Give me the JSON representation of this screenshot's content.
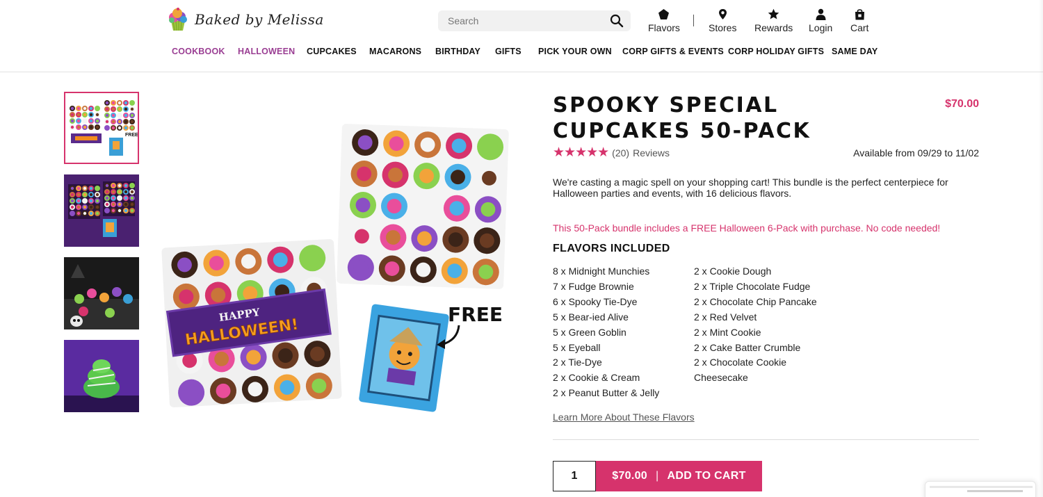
{
  "brand": {
    "logo_text": "Baked by Melissa",
    "primary_color": "#d6336c",
    "accent_purple": "#9a3e93"
  },
  "search": {
    "placeholder": "Search"
  },
  "utility_nav": [
    {
      "label": "Flavors",
      "icon": "flavors-icon"
    },
    {
      "label": "Stores",
      "icon": "map-pin-icon"
    },
    {
      "label": "Rewards",
      "icon": "star-icon"
    },
    {
      "label": "Login",
      "icon": "user-icon"
    },
    {
      "label": "Cart",
      "icon": "shopping-bag-icon"
    }
  ],
  "main_nav": [
    {
      "label": "COOKBOOK",
      "color": "#9a3e93"
    },
    {
      "label": "HALLOWEEN",
      "color": "#9a3e93"
    },
    {
      "label": "CUPCAKES"
    },
    {
      "label": "MACARONS"
    },
    {
      "label": "BIRTHDAY"
    },
    {
      "label": "GIFTS"
    },
    {
      "label": "PICK YOUR OWN"
    },
    {
      "label": "CORP GIFTS & EVENTS"
    },
    {
      "label": "CORP HOLIDAY GIFTS"
    },
    {
      "label": "SAME DAY"
    }
  ],
  "gallery": {
    "thumbnails": [
      {
        "name": "product-thumbnail-bundle",
        "active": true
      },
      {
        "name": "product-thumbnail-purple-boxes"
      },
      {
        "name": "product-thumbnail-party-table"
      },
      {
        "name": "product-thumbnail-green-cupcake"
      }
    ],
    "main_image": {
      "banner_line1": "HAPPY",
      "banner_line2": "HALLOWEEN!",
      "free_label": "FREE"
    }
  },
  "product": {
    "title": "Spooky Special Cupcakes 50-Pack",
    "price": "$70.00",
    "rating": {
      "stars": 5,
      "count": "(20)",
      "label": "Reviews"
    },
    "availability": "Available from 09/29 to 11/02",
    "description": "We're casting a magic spell on your shopping cart! This bundle is the perfect centerpiece for Halloween parties and events, with 16 delicious flavors.",
    "promo": "This 50-Pack bundle includes a FREE Halloween 6-Pack with purchase. No code needed!",
    "flavors_heading": "FLAVORS INCLUDED",
    "flavors_left": [
      "8 x Midnight Munchies",
      "7 x Fudge Brownie",
      "6 x Spooky Tie-Dye",
      "5 x Bear-ied Alive",
      "5 x Green Goblin",
      "5 x Eyeball",
      "2 x Tie-Dye",
      "2 x Cookie & Cream",
      "2 x Peanut Butter & Jelly"
    ],
    "flavors_right": [
      "2 x Cookie Dough",
      "2 x Triple Chocolate Fudge",
      "2 x Chocolate Chip Pancake",
      "2 x Red Velvet",
      "2 x Mint Cookie",
      "2 x Cake Batter Crumble",
      "2 x Chocolate Cookie",
      "Cheesecake"
    ],
    "learn_more": "Learn More About These Flavors",
    "quantity": "1",
    "cart_button": {
      "price": "$70.00",
      "separator": "|",
      "label": "ADD TO CART"
    }
  }
}
